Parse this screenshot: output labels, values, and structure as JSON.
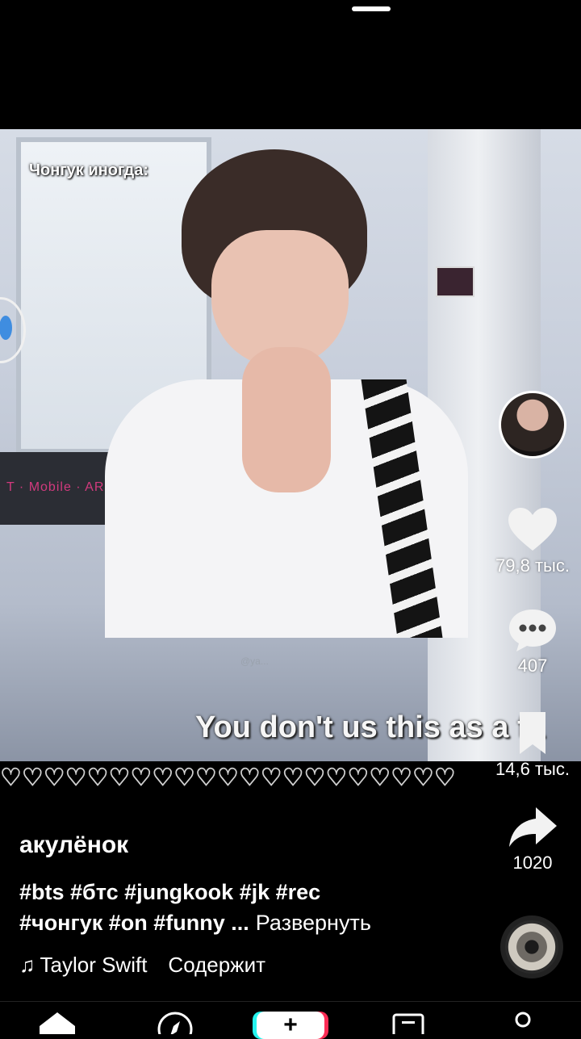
{
  "video": {
    "overlay_caption": "Чонгук иногда:",
    "subtitle": "You don't us this as a fa",
    "watermark": "@ya...",
    "background_sign": "T · Mobile · ARE"
  },
  "hearts_row": "♡♡♡♡♡♡♡♡♡♡♡♡♡♡♡♡♡♡♡♡♡",
  "actions": {
    "likes": "79,8 тыс.",
    "comments": "407",
    "bookmarks": "14,6 тыс.",
    "shares": "1020"
  },
  "post": {
    "author": "акулёнок",
    "tags_line1": "#bts #бтс #jungkook #jk #rec",
    "tags_line2": "#чонгук #on #funny ...",
    "expand_label": "Развернуть",
    "music_note": "♫",
    "music_title": "Taylor Swift",
    "music_contains": "Содержит"
  },
  "icons": {
    "like": "heart-icon",
    "comment": "comment-bubble-icon",
    "bookmark": "bookmark-icon",
    "share": "share-arrow-icon",
    "home": "home-icon",
    "discover": "compass-icon",
    "create": "plus-icon",
    "inbox": "inbox-icon",
    "profile": "profile-icon"
  },
  "colors": {
    "background": "#000000",
    "text": "#ffffff",
    "create_cyan": "#25f4ee",
    "create_red": "#fe2c55"
  }
}
